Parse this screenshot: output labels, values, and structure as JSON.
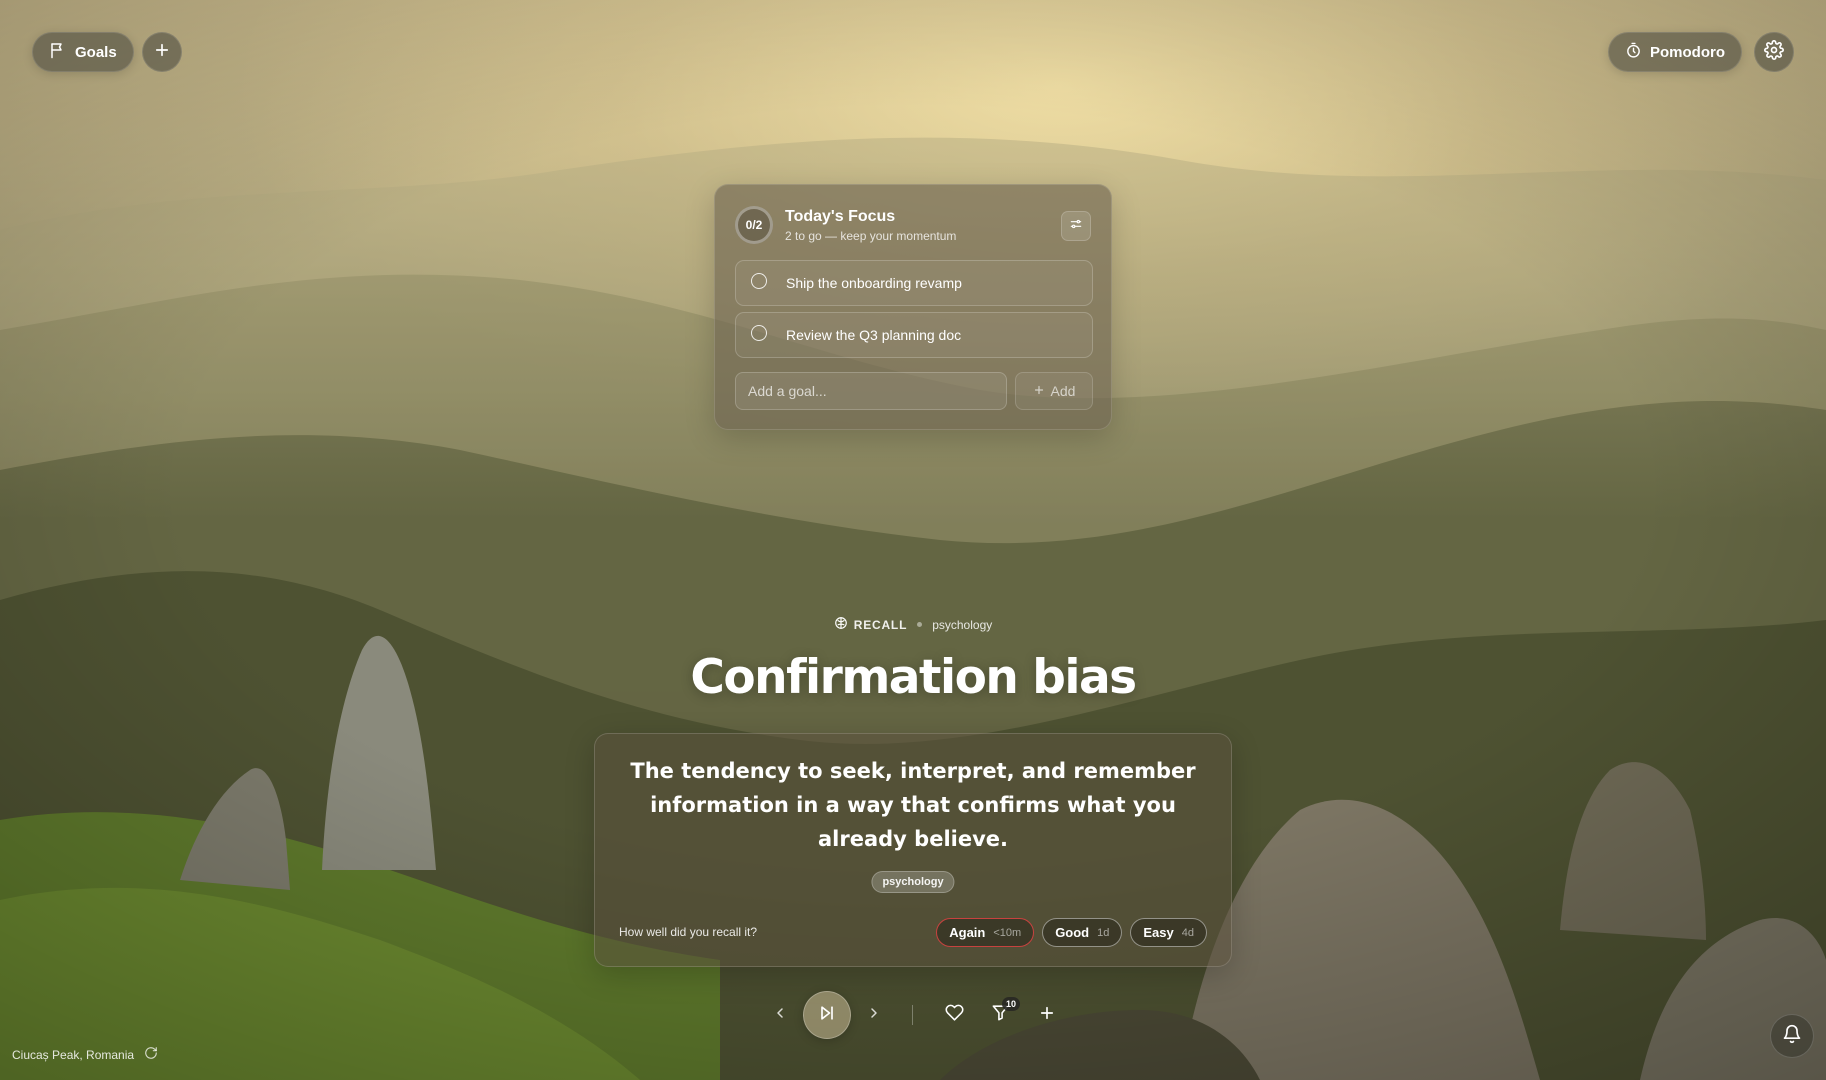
{
  "topbar": {
    "goals_label": "Goals",
    "pomodoro_label": "Pomodoro"
  },
  "focus": {
    "progress": "0/2",
    "title": "Today's Focus",
    "subtitle": "2 to go — keep your momentum",
    "goals": [
      {
        "label": "Ship the onboarding revamp",
        "done": false
      },
      {
        "label": "Review the Q3 planning doc",
        "done": false
      }
    ],
    "input_placeholder": "Add a goal...",
    "add_label": "Add"
  },
  "recall": {
    "mode_label": "RECALL",
    "category": "psychology",
    "term": "Confirmation bias",
    "definition": "The tendency to seek, interpret, and remember information in a way that confirms what you already believe.",
    "tag": "psychology",
    "question": "How well did you recall it?",
    "ratings": [
      {
        "label": "Again",
        "interval": "<10m",
        "color": "#c7423f"
      },
      {
        "label": "Good",
        "interval": "1d"
      },
      {
        "label": "Easy",
        "interval": "4d"
      }
    ]
  },
  "controls": {
    "filter_count": "10"
  },
  "location": "Ciucaș Peak, Romania",
  "icons": {
    "goals": "flag-icon",
    "add": "plus-icon",
    "pomodoro": "timer-icon",
    "settings": "gear-icon",
    "recall": "brain-icon",
    "focus_filter": "sliders-icon",
    "prev": "chevron-left-icon",
    "play": "skip-forward-icon",
    "next": "chevron-right-icon",
    "favorite": "heart-icon",
    "filter": "filter-icon",
    "refresh": "refresh-icon",
    "notifications": "bell-icon"
  }
}
